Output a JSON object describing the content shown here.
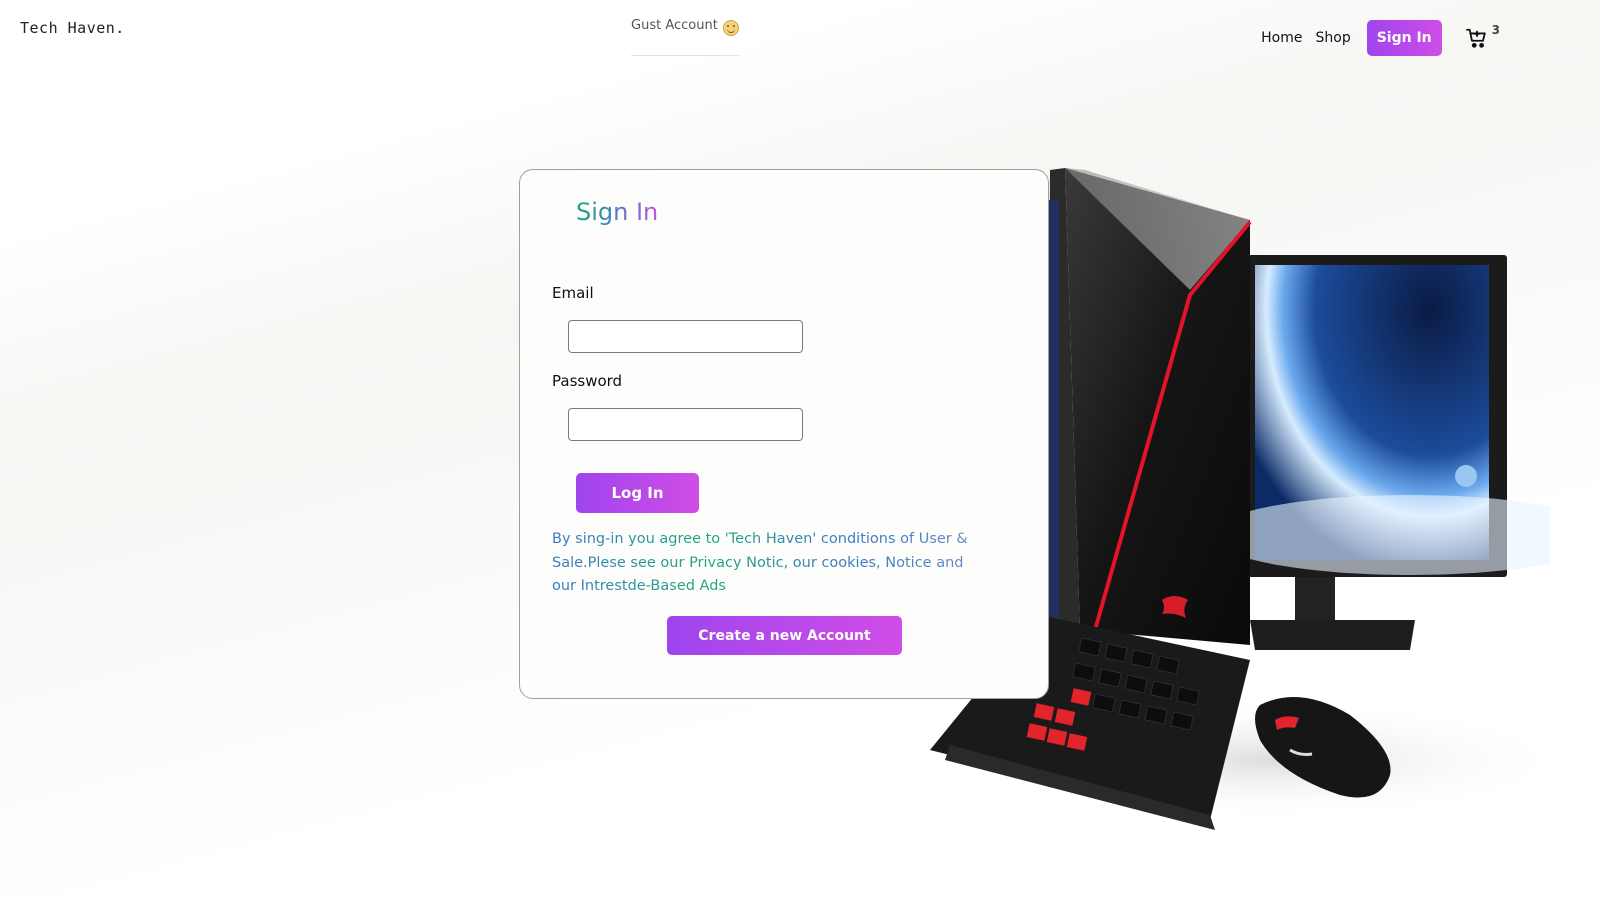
{
  "header": {
    "logo": "Tech Haven.",
    "guest_label": "Gust Account",
    "nav": {
      "home": "Home",
      "shop": "Shop",
      "signin": "Sign In"
    },
    "cart_count": "3"
  },
  "signin_card": {
    "title": "Sign In",
    "email_label": "Email",
    "email_value": "",
    "password_label": "Password",
    "password_value": "",
    "login_button": "Log In",
    "terms_text": "By sing-in you agree to 'Tech Haven' conditions of User & Sale.Plese see our Privacy Notic, our cookies, Notice and our Intrestde-Based Ads",
    "create_account_button": "Create a new Account"
  },
  "colors": {
    "accent_start": "#9f45ee",
    "accent_end": "#d04de6",
    "title_gradient": [
      "#21a87a",
      "#4a7fc8",
      "#c655d8"
    ]
  },
  "icons": {
    "guest": "smiley-icon",
    "cart": "shopping-cart-icon"
  }
}
